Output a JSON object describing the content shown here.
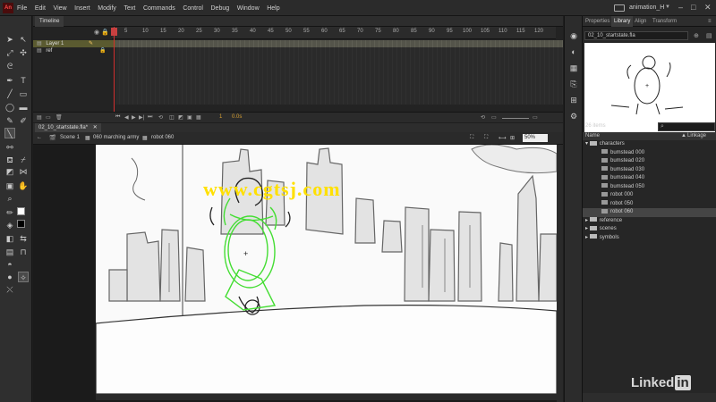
{
  "app": {
    "logo": "An",
    "workspace": "animation_H",
    "win_min": "–",
    "win_max": "□",
    "win_close": "✕"
  },
  "menu": [
    "File",
    "Edit",
    "View",
    "Insert",
    "Modify",
    "Text",
    "Commands",
    "Control",
    "Debug",
    "Window",
    "Help"
  ],
  "timeline": {
    "tab": "Timeline",
    "frame_numbers": [
      "5",
      "10",
      "15",
      "20",
      "25",
      "30",
      "35",
      "40",
      "45",
      "50",
      "55",
      "60",
      "65",
      "70",
      "75",
      "80",
      "85",
      "90",
      "95",
      "100",
      "105",
      "110",
      "115",
      "120"
    ],
    "layers": [
      {
        "name": "Layer 1",
        "active": true
      },
      {
        "name": "ref",
        "active": false
      }
    ],
    "fps": "24.00 fps",
    "time": "0.0s",
    "frame": "1"
  },
  "document": {
    "tab": "02_10_startstate.fla*",
    "scene": "Scene 1",
    "breadcrumb_1": "060 marching army",
    "breadcrumb_2": "robot 060",
    "zoom": "50%"
  },
  "library": {
    "tabs": [
      "Properties",
      "Library",
      "Align",
      "Transform"
    ],
    "document": "02_10_startstate.fla",
    "count": "26 items",
    "col_name": "Name",
    "col_linkage": "Linkage",
    "items": [
      {
        "label": "characters",
        "type": "folder",
        "indent": 0
      },
      {
        "label": "bumstead 000",
        "type": "symbol",
        "indent": 1
      },
      {
        "label": "bumstead 020",
        "type": "symbol",
        "indent": 1
      },
      {
        "label": "bumstead 030",
        "type": "symbol",
        "indent": 1
      },
      {
        "label": "bumstead 040",
        "type": "symbol",
        "indent": 1
      },
      {
        "label": "bumstead 050",
        "type": "symbol",
        "indent": 1
      },
      {
        "label": "robot 000",
        "type": "symbol",
        "indent": 1
      },
      {
        "label": "robot 050",
        "type": "symbol",
        "indent": 1
      },
      {
        "label": "robot 060",
        "type": "symbol",
        "indent": 1,
        "selected": true
      },
      {
        "label": "reference",
        "type": "folder",
        "indent": 0
      },
      {
        "label": "scenes",
        "type": "folder",
        "indent": 0
      },
      {
        "label": "symbols",
        "type": "folder",
        "indent": 0
      }
    ]
  },
  "watermark": {
    "text": "www.cgtsj.com",
    "brand": "Linked",
    "brand_in": "in"
  },
  "colors": {
    "accent_stroke": "#44dd33",
    "watermark": "#ffe000",
    "stage_bg": "#fafafa"
  }
}
